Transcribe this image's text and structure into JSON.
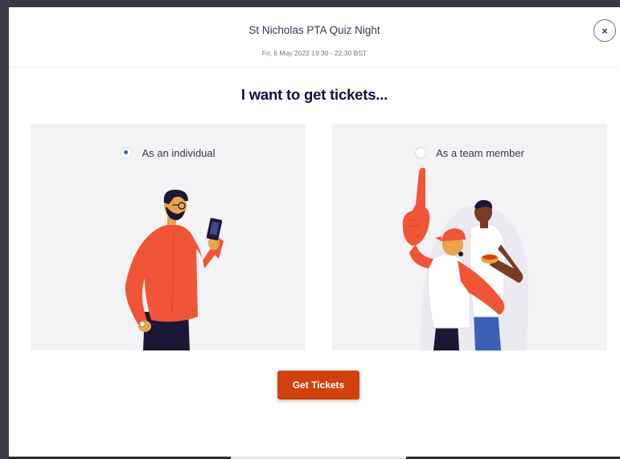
{
  "event": {
    "title": "St Nicholas PTA Quiz Night",
    "date": "Fri, 6 May 2022 19:30 - 22:30 BST"
  },
  "close_icon": "close-icon",
  "close_glyph": "×",
  "heading": "I want to get tickets...",
  "options": [
    {
      "label": "As an individual",
      "selected": true,
      "illustration": "person-with-phone-illustration"
    },
    {
      "label": "As a team member",
      "selected": false,
      "illustration": "team-fans-illustration"
    }
  ],
  "cta": {
    "label": "Get Tickets"
  },
  "colors": {
    "accent": "#d1410c",
    "radio_selected": "#3659e3",
    "card_bg": "#f3f3f6",
    "heading": "#1e0a3c",
    "close_border": "#4b6ad1"
  }
}
